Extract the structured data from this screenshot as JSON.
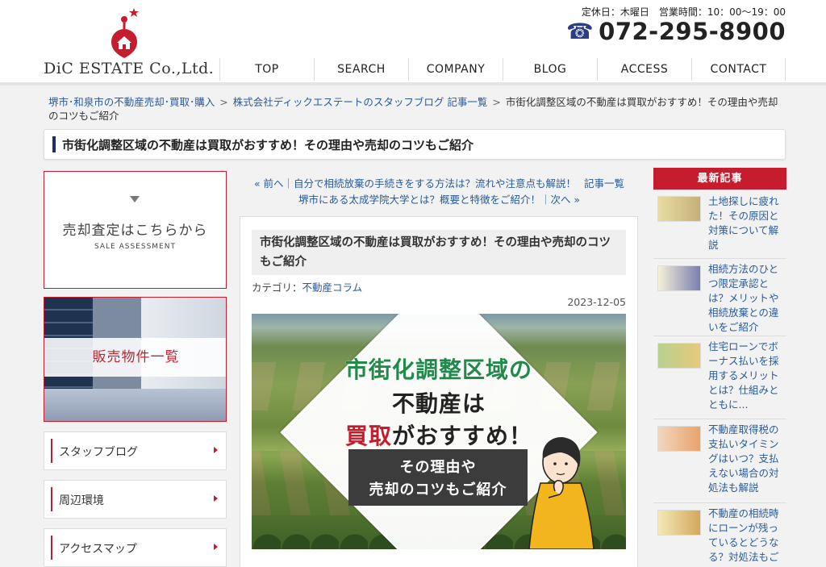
{
  "header": {
    "logo_text": "DiC ESTATE Co.,Ltd.",
    "hours": "定休日：木曜日　営業時間：10：00〜19：00",
    "phone": "072-295-8900",
    "nav": [
      "TOP",
      "SEARCH",
      "COMPANY",
      "BLOG",
      "ACCESS",
      "CONTACT"
    ]
  },
  "breadcrumb": {
    "home": "堺市･和泉市の不動産売却･買取･購入",
    "blog": "株式会社ディックエステートのスタッフブログ 記事一覧",
    "current": "市街化調整区域の不動産は買取がおすすめ！その理由や売却のコツもご紹介",
    "sep": ">"
  },
  "page_title": "市街化調整区域の不動産は買取がおすすめ！その理由や売却のコツもご紹介",
  "left": {
    "assess_title": "売却査定はこちらから",
    "assess_sub": "SALE ASSESSMENT",
    "listing_label": "販売物件一覧",
    "links": [
      "スタッフブログ",
      "周辺環境",
      "アクセスマップ"
    ]
  },
  "pager": {
    "prev": "« 前へ｜自分で相続放棄の手続きをする方法は？流れや注意点も解説！",
    "list": "記事一覧",
    "next": "堺市にある太成学院大学とは？概要と特徴をご紹介！｜次へ »"
  },
  "post": {
    "title": "市街化調整区域の不動産は買取がおすすめ！その理由や売却のコツもご紹介",
    "category_label": "カテゴリ：",
    "category": "不動産コラム",
    "date": "2023-12-05",
    "hero": {
      "line1": "市街化調整区域の",
      "line2": "不動産は",
      "line3_accent": "買取",
      "line3_rest": "がおすすめ！",
      "sub1": "その理由や",
      "sub2": "売却のコツもご紹介"
    }
  },
  "right": {
    "heading": "最新記事",
    "items": [
      "土地探しに疲れた！その原因と対策について解説",
      "相続方法のひとつ限定承認とは？メリットや相続放棄との違いをご紹介",
      "住宅ローンでボーナス払いを採用するメリットとは？仕組みとともに...",
      "不動産取得税の支払いタイミングはいつ？支払えない場合の対処法も解説",
      "不動産の相続時にローンが残っているとどうなる？対処法もご"
    ]
  },
  "colors": {
    "brand_red": "#c51d2e",
    "navy": "#1d2d6b",
    "link_blue": "#2a5a9b"
  }
}
